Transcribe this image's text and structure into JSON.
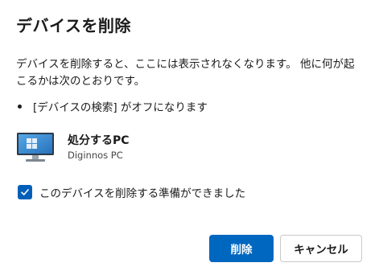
{
  "dialog": {
    "title": "デバイスを削除",
    "description": "デバイスを削除すると、ここには表示されなくなります。 他に何が起こるかは次のとおりです。",
    "bullets": [
      "[デバイスの検索] がオフになります"
    ],
    "device": {
      "name": "処分するPC",
      "subtitle": "Diginnos PC",
      "icon": "desktop-monitor-icon"
    },
    "confirm_checkbox": {
      "label": "このデバイスを削除する準備ができました",
      "checked": true
    },
    "buttons": {
      "remove": "削除",
      "cancel": "キャンセル"
    }
  },
  "colors": {
    "accent": "#0067c0",
    "checkbox": "#005fb8",
    "text": "#1b1b1b"
  }
}
